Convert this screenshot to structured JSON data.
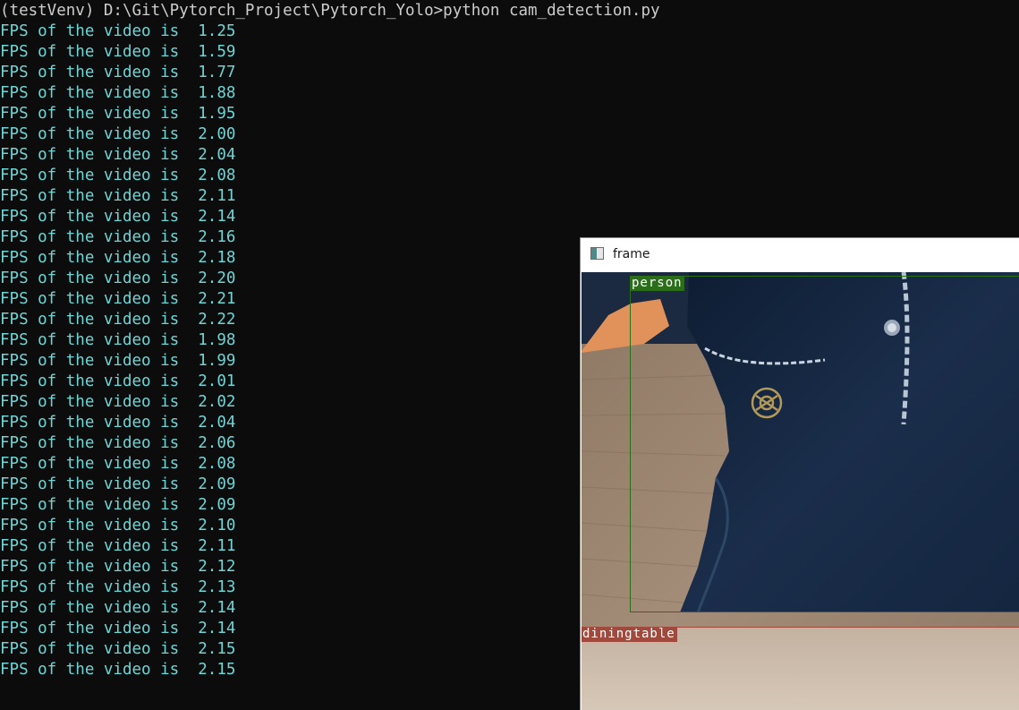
{
  "terminal": {
    "prompt": "(testVenv) D:\\Git\\Pytorch_Project\\Pytorch_Yolo>python cam_detection.py",
    "lines": [
      "FPS of the video is  1.25",
      "FPS of the video is  1.59",
      "FPS of the video is  1.77",
      "FPS of the video is  1.88",
      "FPS of the video is  1.95",
      "FPS of the video is  2.00",
      "FPS of the video is  2.04",
      "FPS of the video is  2.08",
      "FPS of the video is  2.11",
      "FPS of the video is  2.14",
      "FPS of the video is  2.16",
      "FPS of the video is  2.18",
      "FPS of the video is  2.20",
      "FPS of the video is  2.21",
      "FPS of the video is  2.22",
      "FPS of the video is  1.98",
      "FPS of the video is  1.99",
      "FPS of the video is  2.01",
      "FPS of the video is  2.02",
      "FPS of the video is  2.04",
      "FPS of the video is  2.06",
      "FPS of the video is  2.08",
      "FPS of the video is  2.09",
      "FPS of the video is  2.09",
      "FPS of the video is  2.10",
      "FPS of the video is  2.11",
      "FPS of the video is  2.12",
      "FPS of the video is  2.13",
      "FPS of the video is  2.14",
      "FPS of the video is  2.14",
      "FPS of the video is  2.15",
      "FPS of the video is  2.15"
    ],
    "text_color": "#6fd4d4",
    "prompt_color": "#cccccc",
    "background": "#0c0c0c"
  },
  "frame_window": {
    "title": "frame",
    "icon": "window-icon",
    "detections": [
      {
        "label": "person",
        "color": "#2a6e1a"
      },
      {
        "label": "diningtable",
        "color": "#a04a3e"
      }
    ]
  }
}
